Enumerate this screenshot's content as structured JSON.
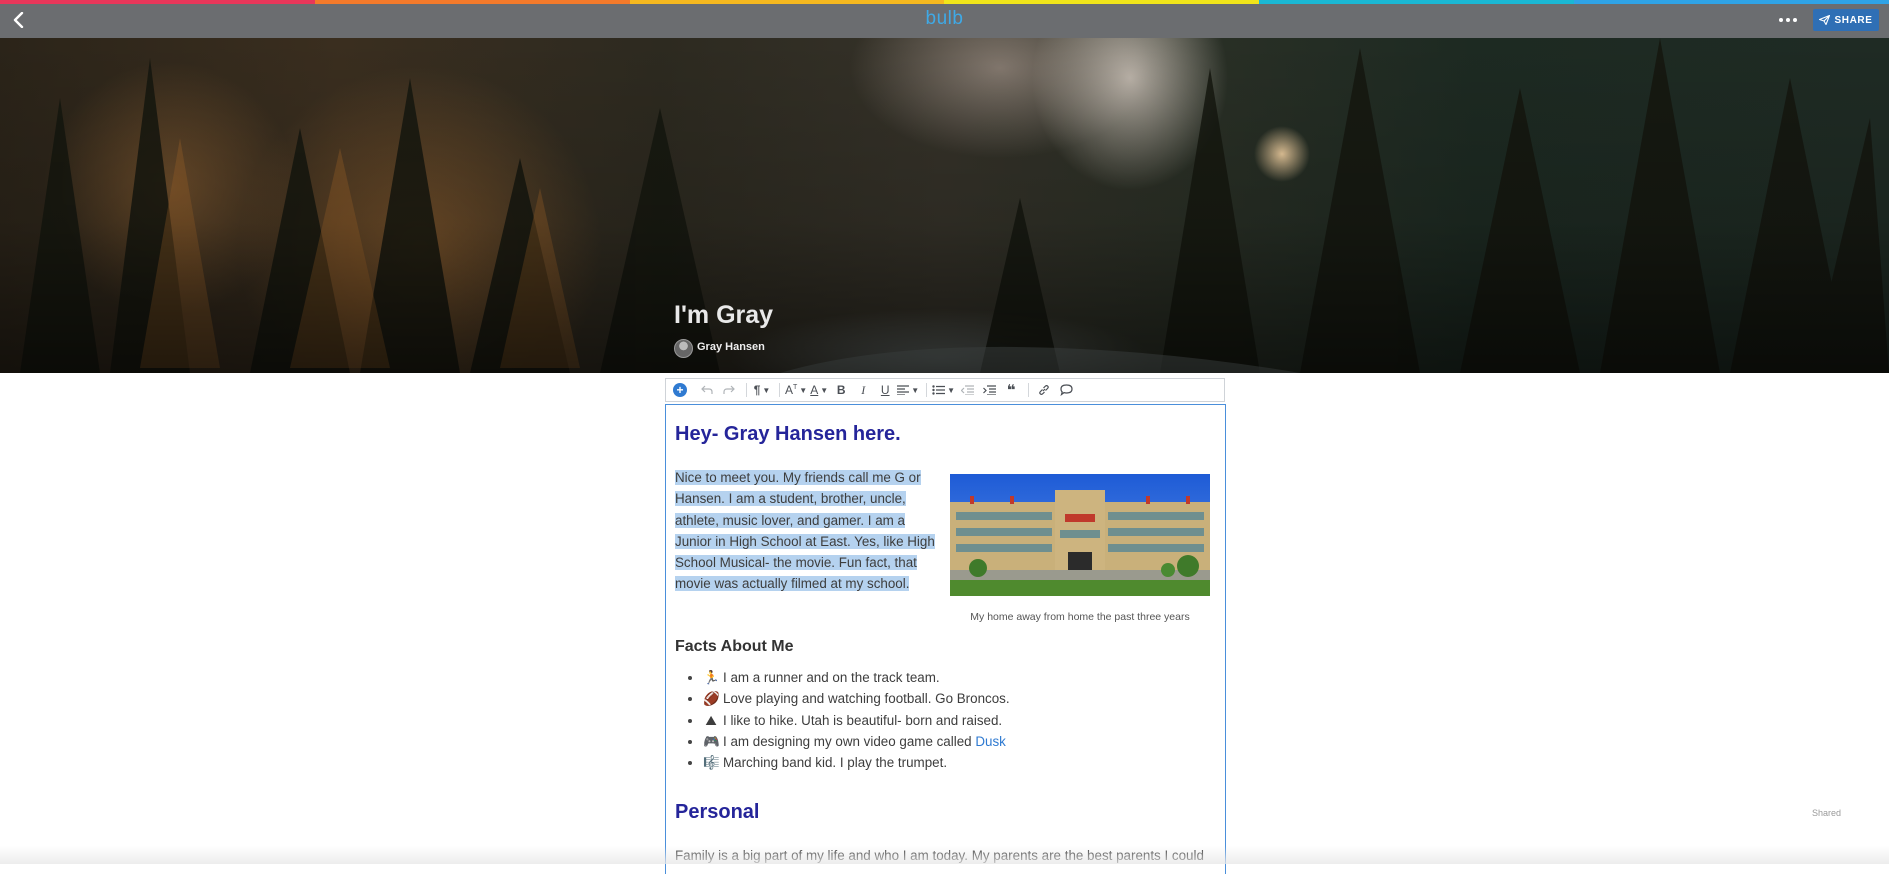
{
  "topbar": {
    "logo": "bulb",
    "share_label": "SHARE",
    "back_icon": "chevron-left-icon",
    "more_icon": "more-horizontal-icon",
    "rainbow_colors": [
      "#e8375a",
      "#f47a2b",
      "#f6b81e",
      "#f1e51a",
      "#1ab8d4",
      "#2fa3e6"
    ]
  },
  "post": {
    "title": "I'm Gray",
    "author": "Gray Hansen"
  },
  "toolbar": {
    "buttons": [
      "add-block-icon",
      "undo-icon",
      "redo-icon",
      "paragraph-format-icon",
      "font-size-icon",
      "text-color-icon",
      "bold-icon",
      "italic-icon",
      "underline-icon",
      "align-icon",
      "list-icon",
      "outdent-icon",
      "indent-icon",
      "quote-icon",
      "link-icon",
      "comment-icon"
    ]
  },
  "content": {
    "heading1": "Hey- Gray Hansen here.",
    "intro": "Nice to meet you. My friends call me G or Hansen. I am a student, brother, uncle, athlete, music lover, and gamer. I am a Junior in High School at East. Yes, like High School Musical- the movie. Fun fact, that movie was actually filmed at my school.",
    "photo_caption": "My home away from home the past three years",
    "facts_heading": "Facts About Me",
    "facts": [
      {
        "emoji": "🏃",
        "text": "I am a runner and on the track team."
      },
      {
        "emoji": "🏈",
        "text": "Love playing and watching football. Go Broncos."
      },
      {
        "emoji": "⛰",
        "text": "I like to hike. Utah is beautiful- born and raised."
      },
      {
        "emoji": "🎮",
        "text": "I am designing my own video game called ",
        "link": "Dusk"
      },
      {
        "emoji": "🎼",
        "text": "Marching band kid. I play the trumpet."
      }
    ],
    "heading2": "Personal",
    "family_text": "Family is a big part of my life and who I am today. My parents are the best parents I could"
  },
  "status": {
    "shared_label": "Shared"
  }
}
